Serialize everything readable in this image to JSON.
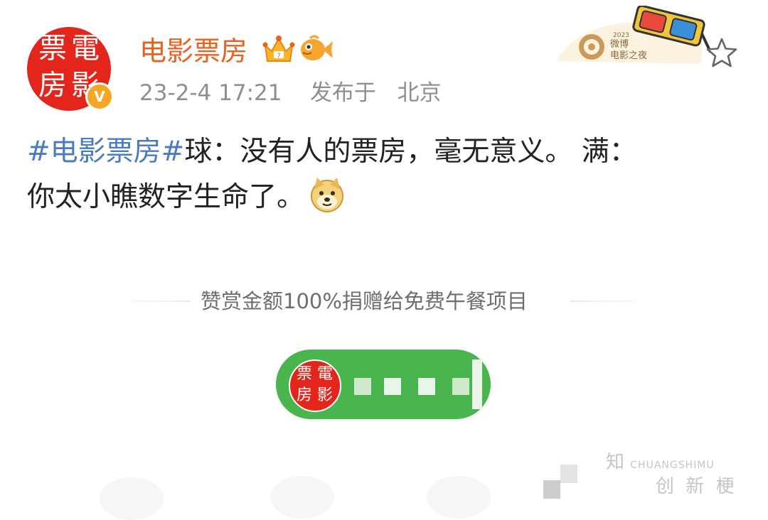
{
  "account": {
    "name": "电影票房",
    "avatar_chars": [
      "票",
      "電",
      "房",
      "影"
    ],
    "verified_mark": "V",
    "date": "23-2-4 17:21",
    "posted_from_label": "发布于",
    "location": "北京",
    "icons": [
      "crown-icon",
      "fish-icon"
    ]
  },
  "event_badge": {
    "year": "2023",
    "line1": "微博",
    "line2": "电影之夜",
    "icon": "3d-glasses-icon"
  },
  "favorite_icon": "star-icon",
  "post": {
    "hashtag": "#电影票房#",
    "body_line1": "球：没有人的票房，毫无意义。 满：",
    "body_line2": "你太小瞧数字生命了。",
    "emoji": "doge-icon"
  },
  "reward": {
    "divider_text": "赞赏金额100%捐赠给免费午餐项目",
    "pill_avatar_chars": [
      "票",
      "電",
      "房",
      "影"
    ]
  },
  "watermark": {
    "line1": "知",
    "line2": "CHUANGSHIMU",
    "line3": "创 新 梗"
  },
  "colors": {
    "brand_orange": "#e8621e",
    "hashtag_blue": "#4a7bbf",
    "reward_green": "#4ab44f",
    "seal_red": "#e3251b"
  }
}
